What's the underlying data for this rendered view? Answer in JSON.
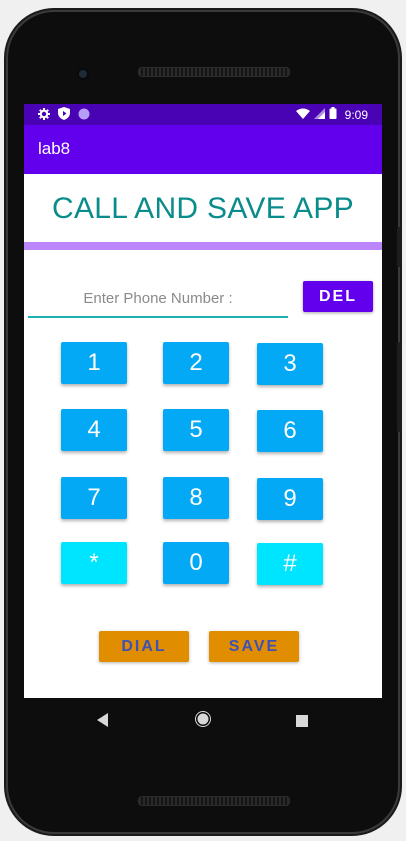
{
  "status_bar": {
    "time": "9:09",
    "icons": [
      "gear-icon",
      "shield-icon",
      "circle-icon",
      "wifi-icon",
      "signal-icon",
      "battery-icon"
    ]
  },
  "app_bar": {
    "title": "lab8"
  },
  "main": {
    "headline": "CALL AND SAVE APP",
    "phone_input": {
      "placeholder": "Enter Phone Number :",
      "value": ""
    },
    "del_label": "DEL",
    "keypad": [
      "1",
      "2",
      "3",
      "4",
      "5",
      "6",
      "7",
      "8",
      "9",
      "*",
      "0",
      "#"
    ],
    "dial_label": "DIAL",
    "save_label": "SAVE"
  },
  "nav_bar": {
    "icons": [
      "back-icon",
      "home-icon",
      "recents-icon"
    ]
  },
  "colors": {
    "status_bar": "#4a03b4",
    "app_bar": "#6200ee",
    "headline": "#0b8c8c",
    "divider": "#bb86fc",
    "key": "#03a9f4",
    "key_alt": "#00e5ff",
    "action_button": "#e08e00",
    "action_text": "#3f51b5"
  }
}
